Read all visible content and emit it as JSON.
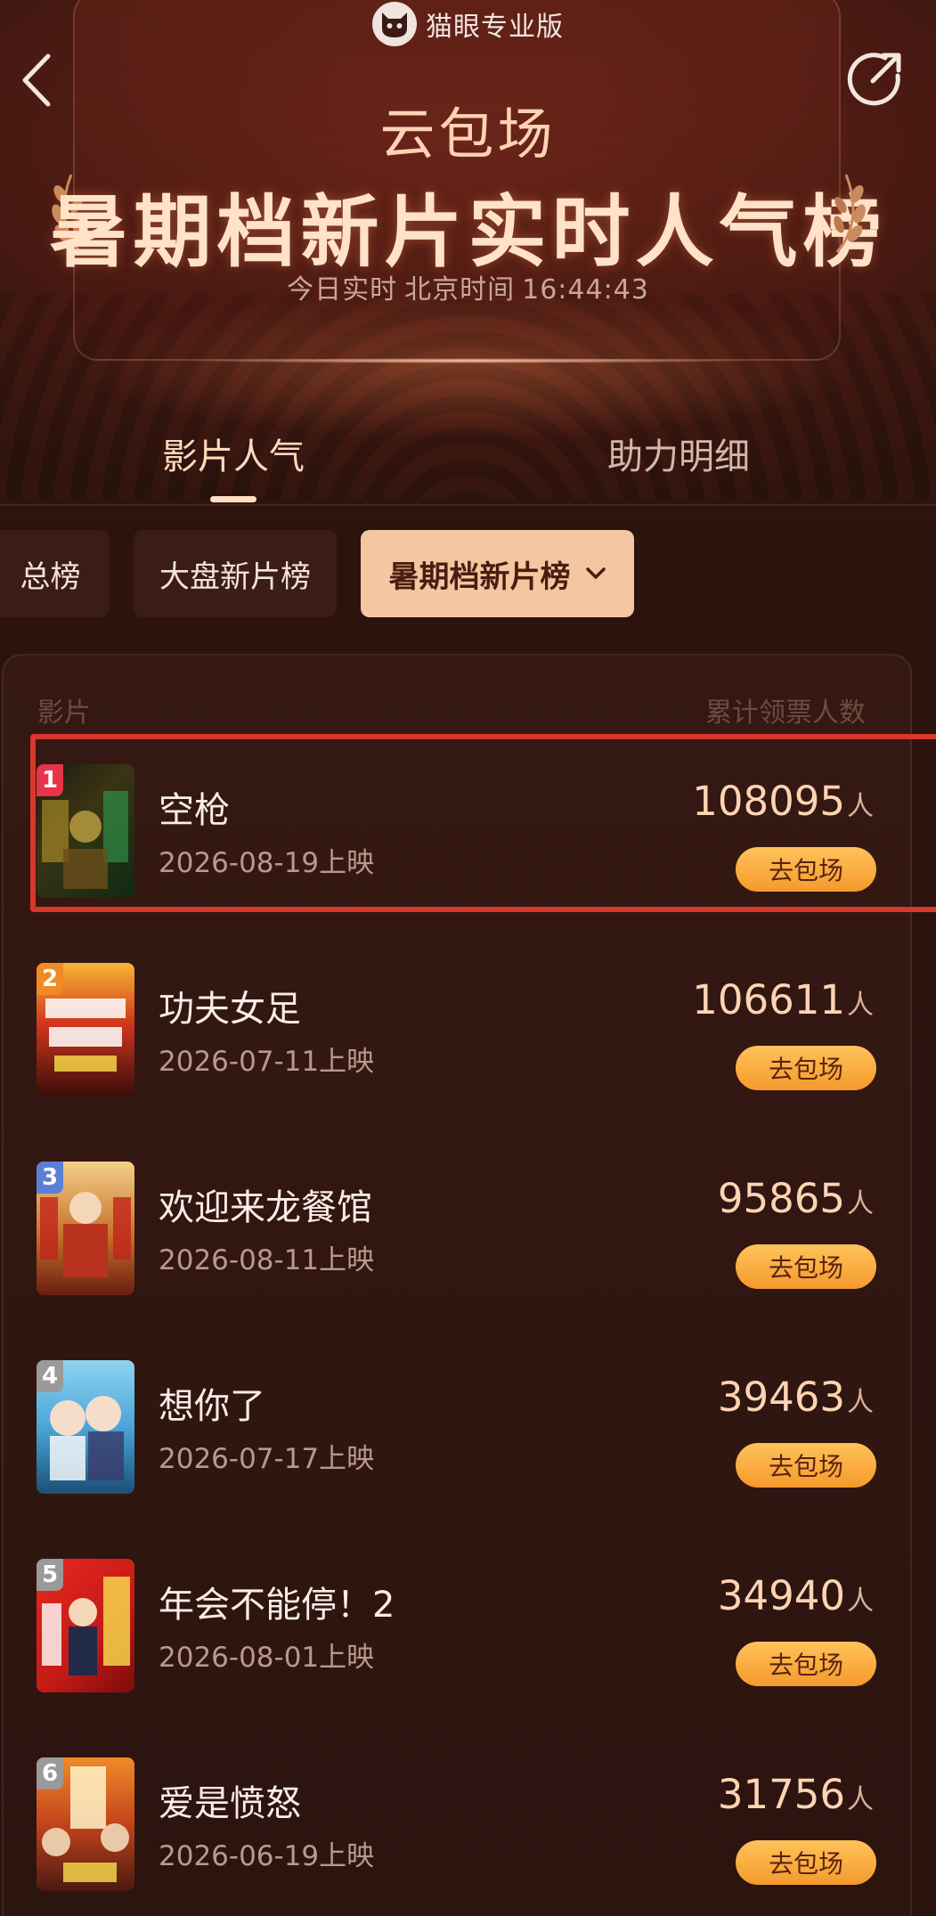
{
  "brand": {
    "text": "猫眼专业版"
  },
  "header": {
    "subtitle": "云包场",
    "title": "暑期档新片实时人气榜",
    "time_prefix": "今日实时",
    "time_zone": "北京时间",
    "time_value": "16:44:43"
  },
  "tabs": [
    {
      "label": "影片人气",
      "active": true
    },
    {
      "label": "助力明细",
      "active": false
    }
  ],
  "filters": [
    {
      "label": "总榜",
      "selected": false
    },
    {
      "label": "大盘新片榜",
      "selected": false
    },
    {
      "label": "暑期档新片榜",
      "selected": true
    }
  ],
  "list": {
    "col_left": "影片",
    "col_right": "累计领票人数",
    "unit": "人",
    "button_label": "去包场",
    "items": [
      {
        "rank": "1",
        "title": "空枪",
        "date": "2026-08-19上映",
        "count": "108095"
      },
      {
        "rank": "2",
        "title": "功夫女足",
        "date": "2026-07-11上映",
        "count": "106611"
      },
      {
        "rank": "3",
        "title": "欢迎来龙餐馆",
        "date": "2026-08-11上映",
        "count": "95865"
      },
      {
        "rank": "4",
        "title": "想你了",
        "date": "2026-07-17上映",
        "count": "39463"
      },
      {
        "rank": "5",
        "title": "年会不能停！2",
        "date": "2026-08-01上映",
        "count": "34940"
      },
      {
        "rank": "6",
        "title": "爱是愤怒",
        "date": "2026-06-19上映",
        "count": "31756"
      }
    ]
  },
  "colors": {
    "accent": "#ffd4b3",
    "button": "#f5a63a",
    "highlight": "#d8372a",
    "rank1": "#e8334a",
    "rank2": "#f08a24",
    "rank3": "#5b7fd6",
    "rank_other": "#9a9a9a"
  },
  "posters": [
    "空枪-poster",
    "功夫女足-poster",
    "欢迎来龙餐馆-poster",
    "想你了-poster",
    "年会不能停2-poster",
    "爱是愤怒-poster"
  ]
}
